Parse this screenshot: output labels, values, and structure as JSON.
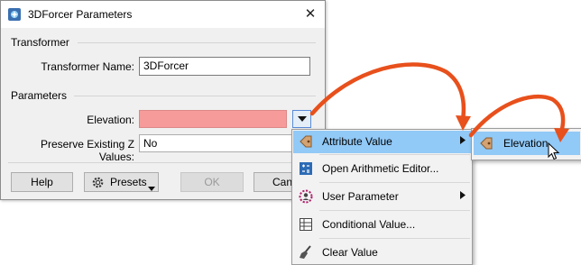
{
  "dialog": {
    "title": "3DForcer Parameters",
    "close_glyph": "✕"
  },
  "transformer_group": {
    "label": "Transformer",
    "name_label": "Transformer Name:",
    "name_value": "3DForcer"
  },
  "parameters_group": {
    "label": "Parameters",
    "elevation_label": "Elevation:",
    "elevation_value": "",
    "elevation_state_color": "#f79a9a",
    "z_label": "Preserve Existing Z Values:",
    "z_value": "No"
  },
  "buttons": {
    "help": "Help",
    "presets": "Presets",
    "ok": "OK",
    "cancel": "Canc"
  },
  "menu": {
    "items": [
      {
        "label": "Attribute Value",
        "icon": "attribute-value-icon",
        "has_submenu": true,
        "highlighted": true
      },
      {
        "label": "Open Arithmetic Editor...",
        "icon": "arithmetic-editor-icon",
        "has_submenu": false
      },
      {
        "label": "User Parameter",
        "icon": "user-parameter-icon",
        "has_submenu": true
      },
      {
        "label": "Conditional Value...",
        "icon": "conditional-value-icon",
        "has_submenu": false
      },
      {
        "label": "Clear Value",
        "icon": "clear-value-icon",
        "has_submenu": false
      }
    ]
  },
  "submenu": {
    "items": [
      {
        "label": "Elevation",
        "icon": "attribute-value-icon",
        "highlighted": true
      }
    ]
  },
  "colors": {
    "highlight": "#91c9f7",
    "annotation_arrow": "#e8501c"
  }
}
